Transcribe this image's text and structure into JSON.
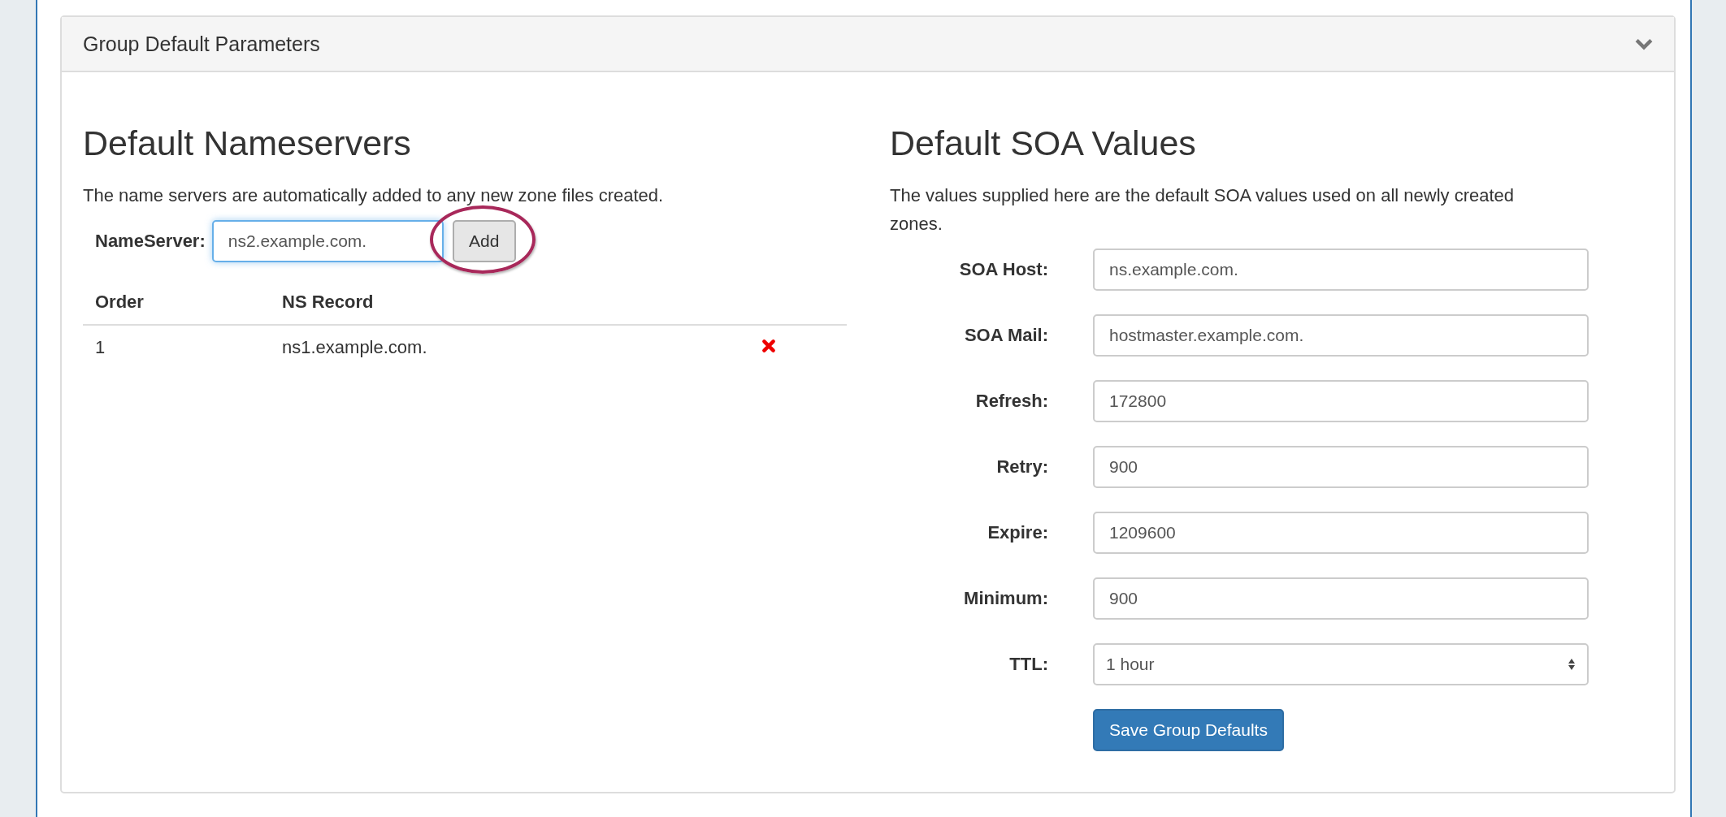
{
  "panel": {
    "title": "Group Default Parameters",
    "expanded": true
  },
  "nameservers": {
    "heading": "Default Nameservers",
    "description": "The name servers are automatically added to any new zone files created.",
    "input_label": "NameServer:",
    "input_value": "ns2.example.com.",
    "add_button": {
      "label": "Add",
      "highlighted": true
    },
    "table": {
      "columns": [
        "Order",
        "NS Record"
      ],
      "rows": [
        {
          "order": "1",
          "record": "ns1.example.com."
        }
      ]
    }
  },
  "soa": {
    "heading": "Default SOA Values",
    "description": "The values supplied here are the default SOA values used on all newly created zones.",
    "fields": [
      {
        "kind": "text",
        "label": "SOA Host:",
        "value": "ns.example.com."
      },
      {
        "kind": "text",
        "label": "SOA Mail:",
        "value": "hostmaster.example.com."
      },
      {
        "kind": "text",
        "label": "Refresh:",
        "value": "172800"
      },
      {
        "kind": "text",
        "label": "Retry:",
        "value": "900"
      },
      {
        "kind": "text",
        "label": "Expire:",
        "value": "1209600"
      },
      {
        "kind": "text",
        "label": "Minimum:",
        "value": "900"
      },
      {
        "kind": "select",
        "label": "TTL:",
        "value": "1 hour"
      }
    ],
    "save_button": "Save Group Defaults"
  }
}
